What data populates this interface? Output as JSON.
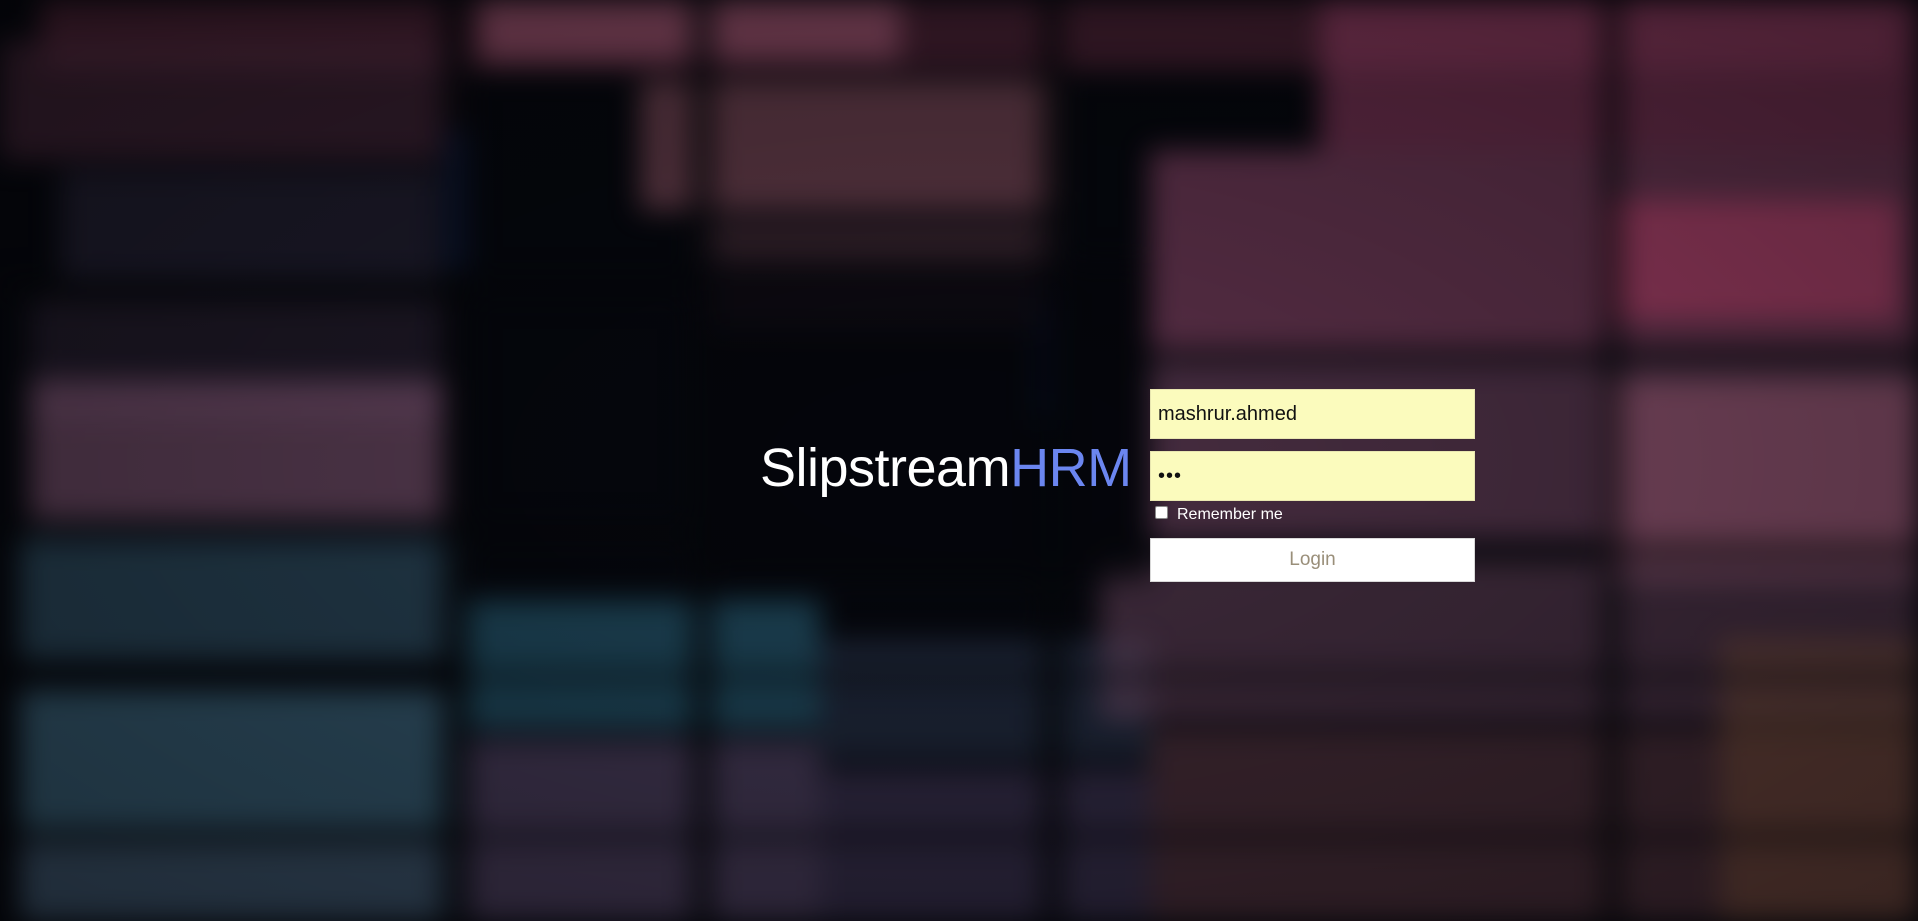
{
  "brand": {
    "name_primary": "Slipstream",
    "name_accent": "HRM",
    "primary_color": "#ffffff",
    "accent_color": "#6b86f0"
  },
  "login_form": {
    "username_value": "mashrur.ahmed",
    "password_value": "•••",
    "remember_label": "Remember me",
    "remember_checked": false,
    "submit_label": "Login"
  },
  "colors": {
    "input_background": "#fbfbbd",
    "button_text": "#9a8f7a",
    "page_background": "#06080f"
  }
}
